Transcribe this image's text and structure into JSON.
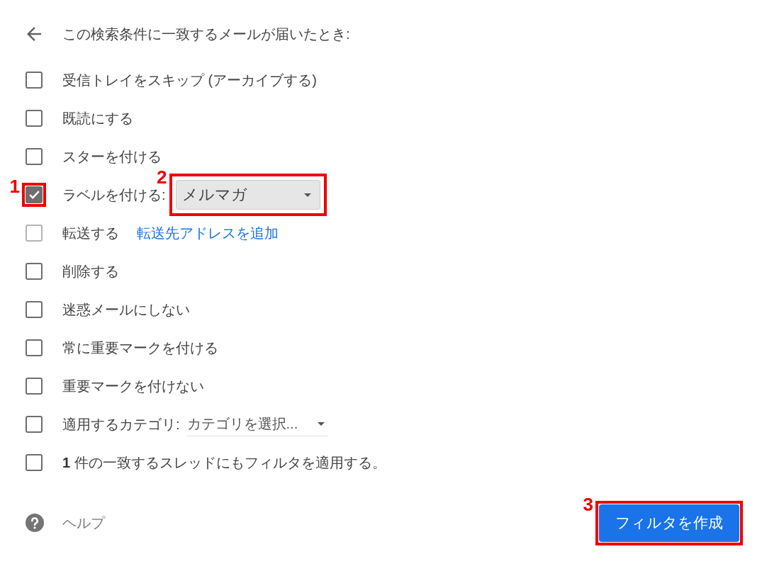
{
  "header": {
    "title": "この検索条件に一致するメールが届いたとき:"
  },
  "actions": [
    {
      "kind": "plain",
      "label": "受信トレイをスキップ (アーカイブする)",
      "checked": false,
      "disabled": false
    },
    {
      "kind": "plain",
      "label": "既読にする",
      "checked": false,
      "disabled": false
    },
    {
      "kind": "plain",
      "label": "スターを付ける",
      "checked": false,
      "disabled": false
    },
    {
      "kind": "label_select",
      "label": "ラベルを付ける:",
      "checked": true,
      "disabled": false,
      "callout": "1",
      "select": {
        "value": "メルマガ",
        "callout": "2"
      }
    },
    {
      "kind": "forward",
      "label": "転送する",
      "checked": false,
      "disabled": true,
      "link": "転送先アドレスを追加"
    },
    {
      "kind": "plain",
      "label": "削除する",
      "checked": false,
      "disabled": false
    },
    {
      "kind": "plain",
      "label": "迷惑メールにしない",
      "checked": false,
      "disabled": false
    },
    {
      "kind": "plain",
      "label": "常に重要マークを付ける",
      "checked": false,
      "disabled": false
    },
    {
      "kind": "plain",
      "label": "重要マークを付けない",
      "checked": false,
      "disabled": false
    },
    {
      "kind": "category_select",
      "label": "適用するカテゴリ:",
      "checked": false,
      "disabled": false,
      "select": {
        "placeholder": "カテゴリを選択..."
      }
    },
    {
      "kind": "plain",
      "label": "**1** 件の一致するスレッドにもフィルタを適用する。",
      "checked": false,
      "disabled": false
    }
  ],
  "help": {
    "label": "ヘルプ"
  },
  "create_button": {
    "label": "フィルタを作成",
    "callout": "3"
  }
}
